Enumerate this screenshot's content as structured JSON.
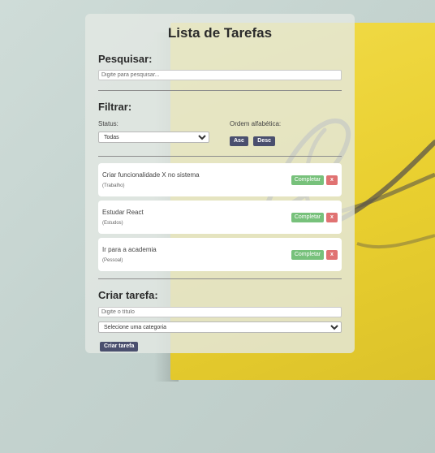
{
  "app": {
    "title": "Lista de Tarefas"
  },
  "search": {
    "heading": "Pesquisar:",
    "placeholder": "Digite para pesquisar...",
    "value": ""
  },
  "filter": {
    "heading": "Filtrar:",
    "status_label": "Status:",
    "status_selected": "Todas",
    "alpha_label": "Ordem alfabética:",
    "asc_label": "Asc",
    "desc_label": "Desc"
  },
  "tasks": [
    {
      "title": "Criar funcionalidade X no sistema",
      "category": "(Trabalho)",
      "complete_label": "Completar",
      "delete_label": "x"
    },
    {
      "title": "Estudar React",
      "category": "(Estudos)",
      "complete_label": "Completar",
      "delete_label": "x"
    },
    {
      "title": "Ir para a academia",
      "category": "(Pessoal)",
      "complete_label": "Completar",
      "delete_label": "x"
    }
  ],
  "create": {
    "heading": "Criar tarefa:",
    "title_placeholder": "Digite o título",
    "category_selected": "Selecione uma categoria",
    "submit_label": "Criar tarefa"
  },
  "colors": {
    "primary": "#4a4f6e",
    "complete": "#77c17b",
    "delete": "#e07272",
    "note_yellow": "#eed43a"
  }
}
